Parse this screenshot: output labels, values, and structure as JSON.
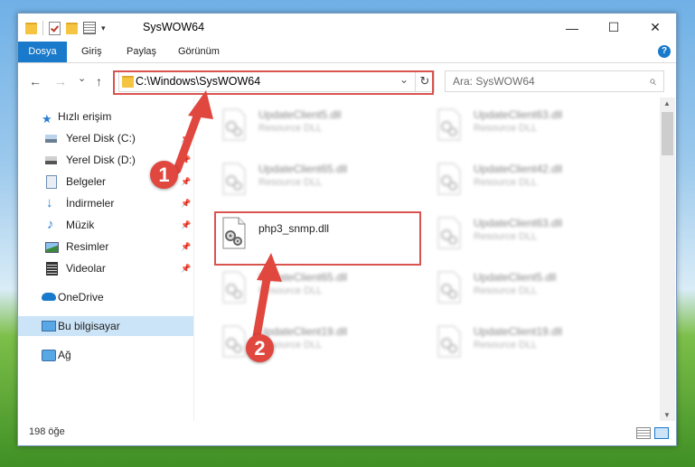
{
  "window": {
    "title": "SysWOW64",
    "minimize_glyph": "—",
    "maximize_glyph": "☐",
    "close_glyph": "✕"
  },
  "ribbon": {
    "tabs": [
      {
        "label": "Dosya",
        "active": true
      },
      {
        "label": "Giriş"
      },
      {
        "label": "Paylaş"
      },
      {
        "label": "Görünüm"
      }
    ],
    "help_glyph": "?"
  },
  "navigation": {
    "back_glyph": "←",
    "forward_glyph": "→",
    "recent_glyph": "⌄",
    "up_glyph": "↑",
    "address": "C:\\Windows\\SysWOW64",
    "address_dropdown_glyph": "⌄",
    "refresh_glyph": "↻",
    "search_placeholder": "Ara: SysWOW64",
    "search_glyph": "⌕"
  },
  "sidebar": {
    "items": [
      {
        "label": "Hızlı erişim",
        "icon": "star-icon"
      },
      {
        "label": "Yerel Disk (C:)",
        "icon": "drive-icon",
        "pinned": true
      },
      {
        "label": "Yerel Disk (D:)",
        "icon": "drive-icon",
        "pinned": true
      },
      {
        "label": "Belgeler",
        "icon": "documents-icon",
        "pinned": true
      },
      {
        "label": "İndirmeler",
        "icon": "download-icon",
        "pinned": true
      },
      {
        "label": "Müzik",
        "icon": "music-icon",
        "pinned": true
      },
      {
        "label": "Resimler",
        "icon": "pictures-icon",
        "pinned": true
      },
      {
        "label": "Videolar",
        "icon": "videos-icon",
        "pinned": true
      },
      {
        "label": "OneDrive",
        "icon": "onedrive-icon"
      },
      {
        "label": "Bu bilgisayar",
        "icon": "computer-icon",
        "selected": true
      },
      {
        "label": "Ağ",
        "icon": "network-icon"
      }
    ],
    "pin_glyph": "📌"
  },
  "files": {
    "left_column": [
      {
        "name": "UpdateClient5.dll",
        "type": "Resource DLL"
      },
      {
        "name": "UpdateClient65.dll",
        "type": "Resource DLL"
      },
      {
        "name": "php3_snmp.dll",
        "type": ""
      },
      {
        "name": "UpdateClient65.dll",
        "type": "Resource DLL"
      },
      {
        "name": "UpdateClient19.dll",
        "type": "Resource DLL"
      }
    ],
    "right_column": [
      {
        "name": "UpdateClient63.dll",
        "type": "Resource DLL"
      },
      {
        "name": "UpdateClient42.dll",
        "type": "Resource DLL"
      },
      {
        "name": "UpdateClient63.dll",
        "type": "Resource DLL"
      },
      {
        "name": "UpdateClient5.dll",
        "type": "Resource DLL"
      },
      {
        "name": "UpdateClient19.dll",
        "type": "Resource DLL"
      }
    ]
  },
  "status": {
    "item_count": "198 öğe"
  },
  "annotations": {
    "marker1": "1",
    "marker2": "2",
    "color": "#e0473f"
  }
}
